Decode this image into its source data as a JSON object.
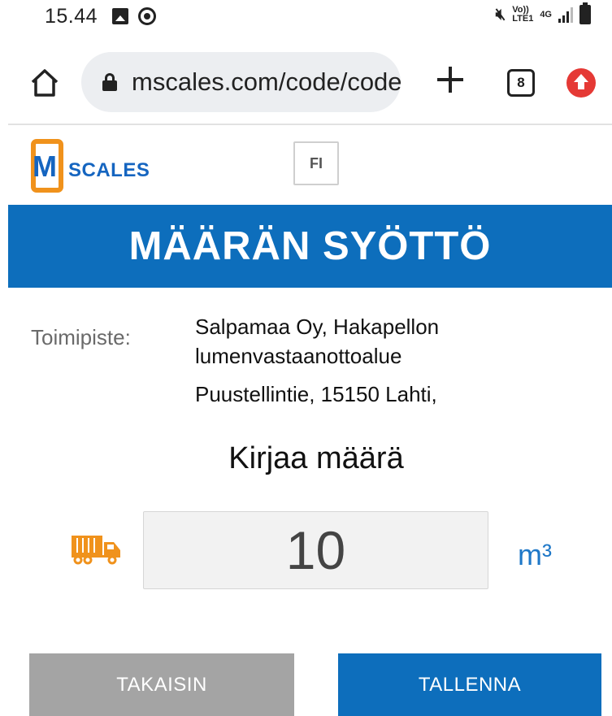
{
  "status_bar": {
    "time": "15.44",
    "volte_line1": "Vo))",
    "volte_line2": "LTE1",
    "network": "4G"
  },
  "browser": {
    "url": "mscales.com/code/code",
    "tab_count": "8"
  },
  "header": {
    "logo_letter": "M",
    "logo_text": "SCALES",
    "language": "FI"
  },
  "page": {
    "title": "MÄÄRÄN SYÖTTÖ",
    "location_label": "Toimipiste:",
    "location_name": "Salpamaa Oy, Hakapellon lumenvastaanottoalue",
    "location_address": "Puustellintie, 15150 Lahti,",
    "prompt": "Kirjaa määrä",
    "quantity_value": "10",
    "unit": "m³"
  },
  "buttons": {
    "back_label": "TAKAISIN",
    "save_label": "TALLENNA"
  },
  "colors": {
    "brand_blue": "#0d6ebc",
    "brand_orange": "#f0921c",
    "button_gray": "#a4a4a4"
  }
}
